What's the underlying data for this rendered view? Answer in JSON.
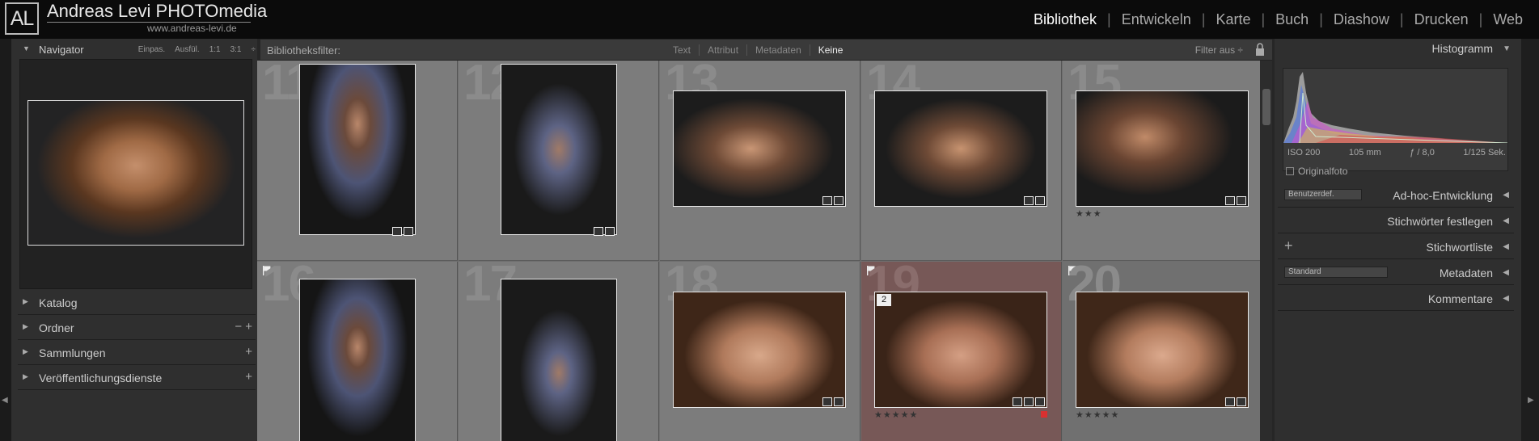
{
  "brand": {
    "logo_text": "AL",
    "name": "Andreas Levi PHOTOmedia",
    "url": "www.andreas-levi.de"
  },
  "modules": [
    "Bibliothek",
    "Entwickeln",
    "Karte",
    "Buch",
    "Diashow",
    "Drucken",
    "Web"
  ],
  "active_module": "Bibliothek",
  "navigator": {
    "title": "Navigator",
    "zooms": [
      "Einpas.",
      "Ausfül.",
      "1:1",
      "3:1"
    ]
  },
  "left_sections": [
    {
      "label": "Katalog",
      "action": ""
    },
    {
      "label": "Ordner",
      "action": "− +"
    },
    {
      "label": "Sammlungen",
      "action": "+"
    },
    {
      "label": "Veröffentlichungsdienste",
      "action": "+"
    }
  ],
  "filter_bar": {
    "label": "Bibliotheksfilter:",
    "tabs": [
      "Text",
      "Attribut",
      "Metadaten",
      "Keine"
    ],
    "active_tab": "Keine",
    "filter_state": "Filter aus ÷"
  },
  "grid": [
    {
      "number": "11",
      "stars": "",
      "flag": false,
      "stack": "",
      "selected": false
    },
    {
      "number": "12",
      "stars": "",
      "flag": false,
      "stack": "",
      "selected": false
    },
    {
      "number": "13",
      "stars": "",
      "flag": false,
      "stack": "",
      "selected": false
    },
    {
      "number": "14",
      "stars": "",
      "flag": false,
      "stack": "",
      "selected": false
    },
    {
      "number": "15",
      "stars": "★★★",
      "flag": false,
      "stack": "",
      "selected": false
    },
    {
      "number": "16",
      "stars": "",
      "flag": true,
      "stack": "",
      "selected": false
    },
    {
      "number": "17",
      "stars": "",
      "flag": false,
      "stack": "",
      "selected": false
    },
    {
      "number": "18",
      "stars": "",
      "flag": false,
      "stack": "",
      "selected": false
    },
    {
      "number": "19",
      "stars": "★★★★★",
      "flag": true,
      "stack": "2",
      "selected": true
    },
    {
      "number": "20",
      "stars": "★★★★★",
      "flag": true,
      "stack": "",
      "selected": false
    }
  ],
  "histogram": {
    "title": "Histogramm",
    "iso": "ISO 200",
    "focal": "105 mm",
    "aperture": "ƒ / 8,0",
    "shutter": "1/125 Sek.",
    "original_label": "Originalfoto"
  },
  "right_sections": [
    {
      "label": "Ad-hoc-Entwicklung",
      "preset": "Benutzerdef.",
      "plus": false
    },
    {
      "label": "Stichwörter festlegen",
      "preset": "",
      "plus": false
    },
    {
      "label": "Stichwortliste",
      "preset": "",
      "plus": true
    },
    {
      "label": "Metadaten",
      "preset": "Standard",
      "plus": false
    },
    {
      "label": "Kommentare",
      "preset": "",
      "plus": false
    }
  ],
  "colors": {
    "selected_cell": "#775857",
    "accent_red": "#d93030"
  }
}
